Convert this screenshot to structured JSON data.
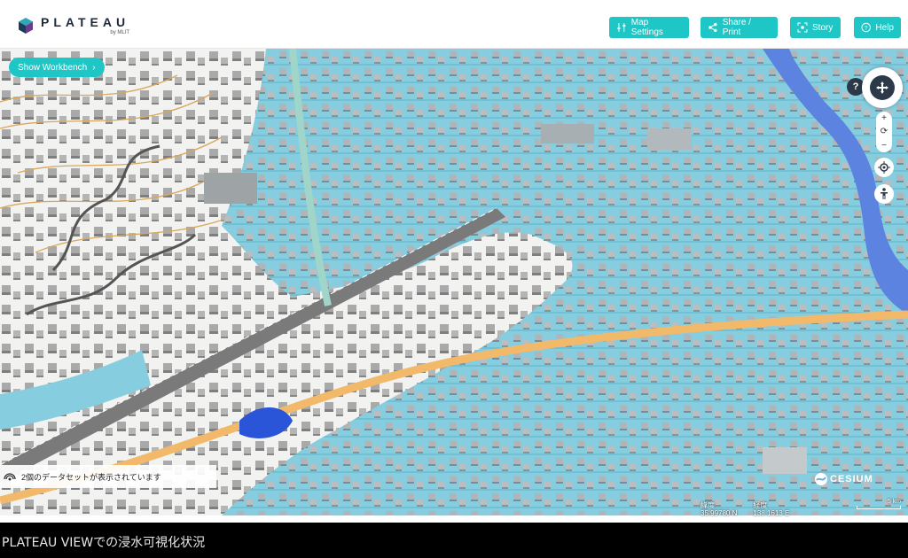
{
  "app": {
    "name": "PLATEAU",
    "byline": "by MLIT"
  },
  "header": {
    "buttons": [
      {
        "label": "Map Settings",
        "icon": "sliders-icon"
      },
      {
        "label": "Share / Print",
        "icon": "share-icon"
      },
      {
        "label": "Story",
        "icon": "story-icon"
      },
      {
        "label": "Help",
        "icon": "help-icon"
      }
    ]
  },
  "workbench": {
    "label": "Show Workbench"
  },
  "nav": {
    "help_label": "?"
  },
  "zoom": {
    "in": "+",
    "reset": "⟳",
    "out": "−"
  },
  "status": {
    "datasets_text": "2個のデータセットが表示されています"
  },
  "attribution": {
    "cesium": "CESIUM"
  },
  "location": {
    "lat_label": "緯度",
    "lat_value": "35.99780 N",
    "lon_label": "経度",
    "lon_value": "138.1613 E"
  },
  "scale": {
    "label": "5 km"
  },
  "caption": "PLATEAU VIEWでの浸水可視化状況",
  "colors": {
    "accent": "#1ec6c6",
    "flood": "#7ccbe0",
    "dark": "#2b3948"
  }
}
